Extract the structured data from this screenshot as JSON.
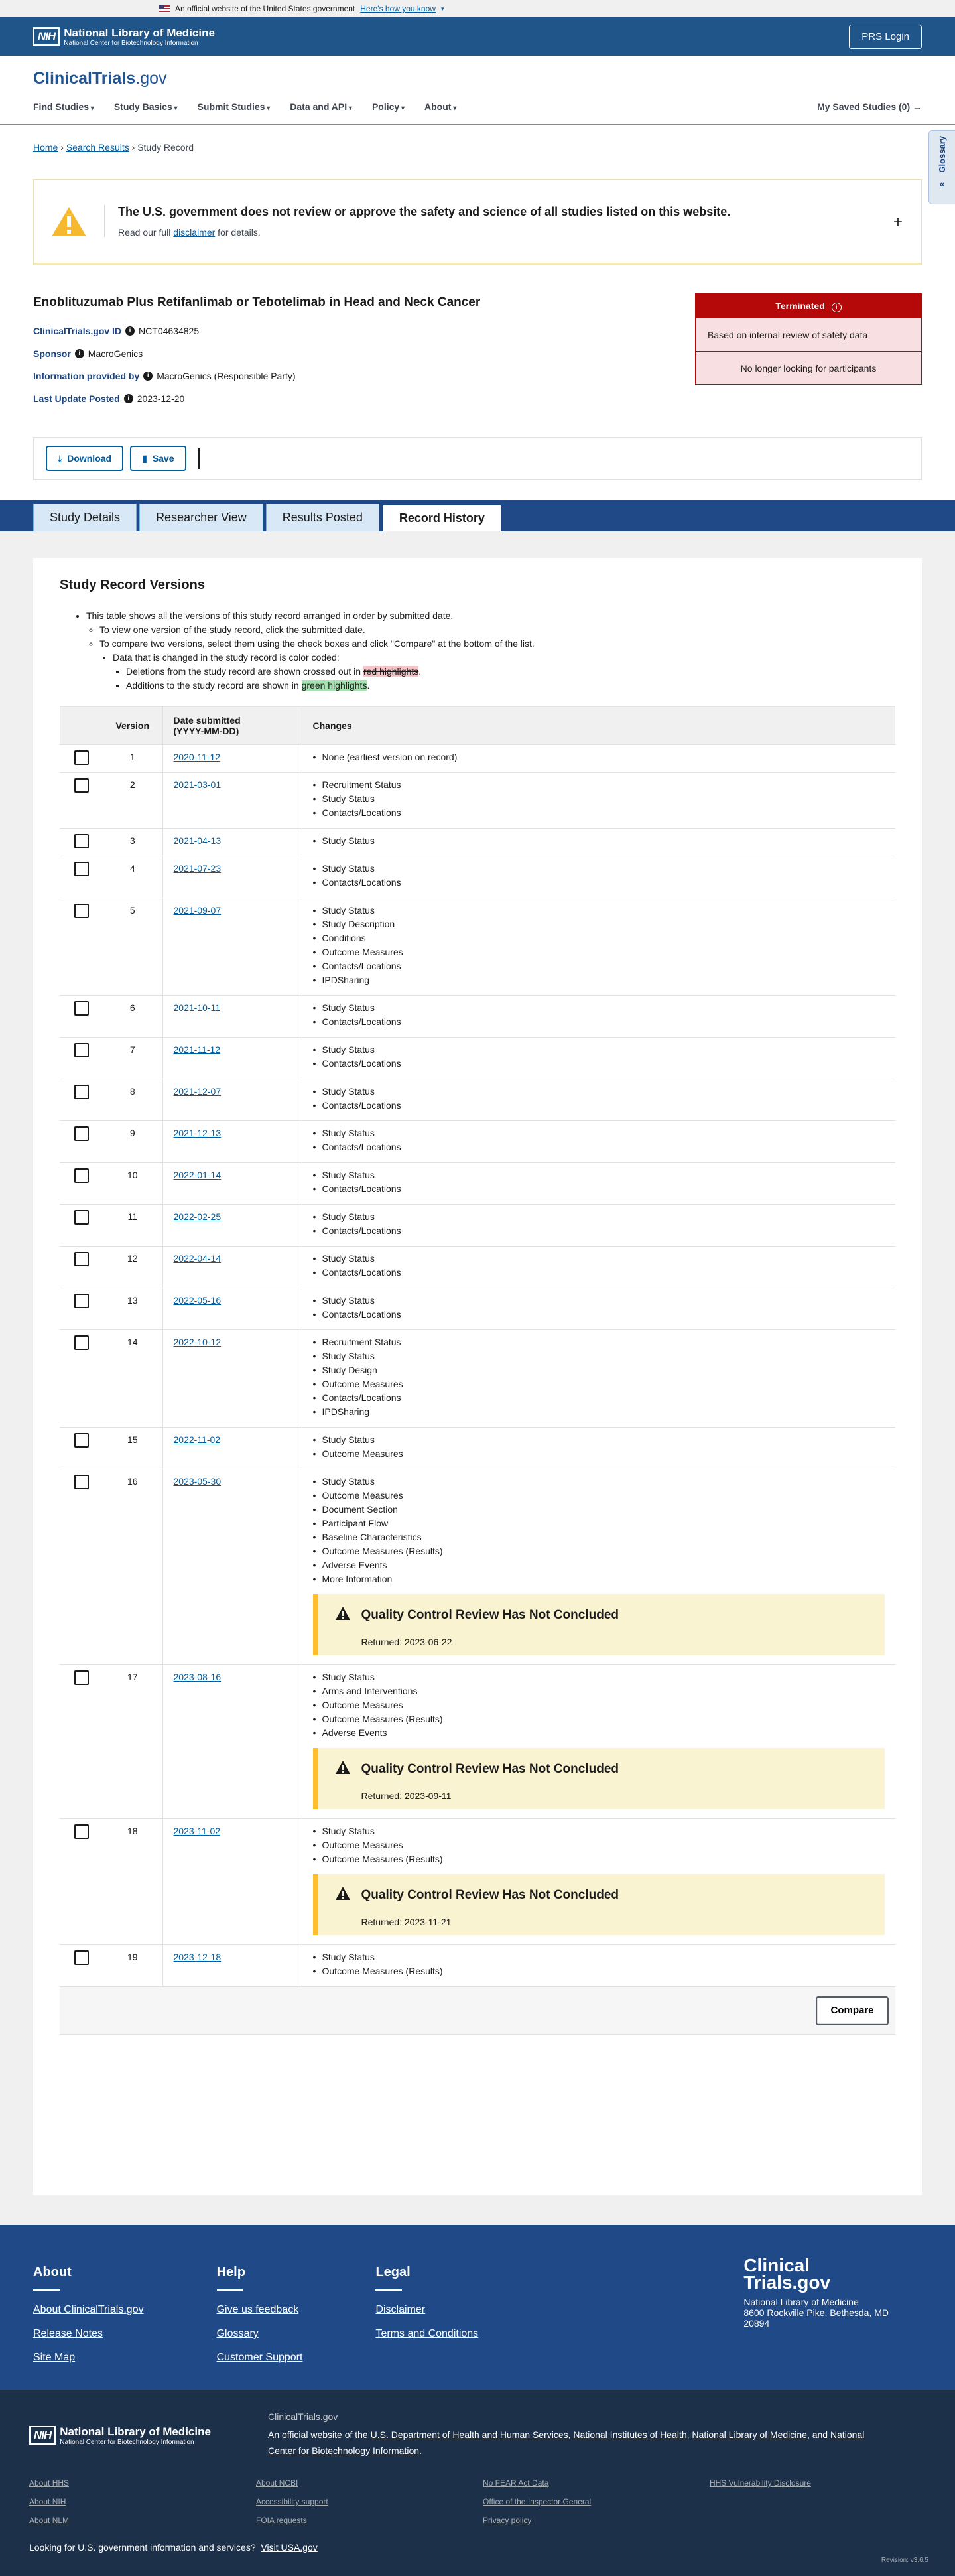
{
  "gov_banner": {
    "text": "An official website of the United States government",
    "link": "Here's how you know"
  },
  "nlm": {
    "abbr": "NIH",
    "line1": "National Library of Medicine",
    "line2": "National Center for Biotechnology Information",
    "prs": "PRS Login"
  },
  "header": {
    "logo_a": "ClinicalTrials",
    "logo_b": ".gov",
    "nav": [
      "Find Studies",
      "Study Basics",
      "Submit Studies",
      "Data and API",
      "Policy",
      "About"
    ],
    "saved": "My Saved Studies (0) →"
  },
  "breadcrumb": {
    "home": "Home",
    "results": "Search Results",
    "current": "Study Record"
  },
  "glossary": "Glossary",
  "notice": {
    "title": "The U.S. government does not review or approve the safety and science of all studies listed on this website.",
    "pre": "Read our full ",
    "link": "disclaimer",
    "post": " for details."
  },
  "study": {
    "title": "Enoblituzumab Plus Retifanlimab or Tebotelimab in Head and Neck Cancer",
    "id_label": "ClinicalTrials.gov ID",
    "id": "NCT04634825",
    "sponsor_label": "Sponsor",
    "sponsor": "MacroGenics",
    "info_label": "Information provided by",
    "info": "MacroGenics (Responsible Party)",
    "update_label": "Last Update Posted",
    "update": "2023-12-20"
  },
  "status": {
    "label": "Terminated",
    "reason": "Based on internal review of safety data",
    "recruit": "No longer looking for participants",
    "color": "#b50909"
  },
  "actions": {
    "download": "Download",
    "save": "Save"
  },
  "tabs": [
    "Study Details",
    "Researcher View",
    "Results Posted",
    "Record History"
  ],
  "versions": {
    "heading": "Study Record Versions",
    "intro": "This table shows all the versions of this study record arranged in order by submitted date.",
    "b1": "To view one version of the study record, click the submitted date.",
    "b2": "To compare two versions, select them using the check boxes and click \"Compare\" at the bottom of the list.",
    "b3": "Data that is changed in the study record is color coded:",
    "del_pre": "Deletions from the study record are shown crossed out in ",
    "del_hl": "red highlights",
    "del_post": ".",
    "add_pre": "Additions to the study record are shown in ",
    "add_hl": "green highlights",
    "add_post": ".",
    "col_version": "Version",
    "col_date1": "Date submitted",
    "col_date2": "(YYYY-MM-DD)",
    "col_changes": "Changes",
    "qc_title": "Quality Control Review Has Not Concluded",
    "compare": "Compare"
  },
  "rows": [
    {
      "v": "1",
      "date": "2020-11-12",
      "changes": [
        "None (earliest version on record)"
      ]
    },
    {
      "v": "2",
      "date": "2021-03-01",
      "changes": [
        "Recruitment Status",
        "Study Status",
        "Contacts/Locations"
      ]
    },
    {
      "v": "3",
      "date": "2021-04-13",
      "changes": [
        "Study Status"
      ]
    },
    {
      "v": "4",
      "date": "2021-07-23",
      "changes": [
        "Study Status",
        "Contacts/Locations"
      ]
    },
    {
      "v": "5",
      "date": "2021-09-07",
      "changes": [
        "Study Status",
        "Study Description",
        "Conditions",
        "Outcome Measures",
        "Contacts/Locations",
        "IPDSharing"
      ]
    },
    {
      "v": "6",
      "date": "2021-10-11",
      "changes": [
        "Study Status",
        "Contacts/Locations"
      ]
    },
    {
      "v": "7",
      "date": "2021-11-12",
      "changes": [
        "Study Status",
        "Contacts/Locations"
      ]
    },
    {
      "v": "8",
      "date": "2021-12-07",
      "changes": [
        "Study Status",
        "Contacts/Locations"
      ]
    },
    {
      "v": "9",
      "date": "2021-12-13",
      "changes": [
        "Study Status",
        "Contacts/Locations"
      ]
    },
    {
      "v": "10",
      "date": "2022-01-14",
      "changes": [
        "Study Status",
        "Contacts/Locations"
      ]
    },
    {
      "v": "11",
      "date": "2022-02-25",
      "changes": [
        "Study Status",
        "Contacts/Locations"
      ]
    },
    {
      "v": "12",
      "date": "2022-04-14",
      "changes": [
        "Study Status",
        "Contacts/Locations"
      ]
    },
    {
      "v": "13",
      "date": "2022-05-16",
      "changes": [
        "Study Status",
        "Contacts/Locations"
      ]
    },
    {
      "v": "14",
      "date": "2022-10-12",
      "changes": [
        "Recruitment Status",
        "Study Status",
        "Study Design",
        "Outcome Measures",
        "Contacts/Locations",
        "IPDSharing"
      ]
    },
    {
      "v": "15",
      "date": "2022-11-02",
      "changes": [
        "Study Status",
        "Outcome Measures"
      ]
    },
    {
      "v": "16",
      "date": "2023-05-30",
      "changes": [
        "Study Status",
        "Outcome Measures",
        "Document Section",
        "Participant Flow",
        "Baseline Characteristics",
        "Outcome Measures (Results)",
        "Adverse Events",
        "More Information"
      ],
      "qc": "Returned: 2023-06-22"
    },
    {
      "v": "17",
      "date": "2023-08-16",
      "changes": [
        "Study Status",
        "Arms and Interventions",
        "Outcome Measures",
        "Outcome Measures (Results)",
        "Adverse Events"
      ],
      "qc": "Returned: 2023-09-11"
    },
    {
      "v": "18",
      "date": "2023-11-02",
      "changes": [
        "Study Status",
        "Outcome Measures",
        "Outcome Measures (Results)"
      ],
      "qc": "Returned: 2023-11-21"
    },
    {
      "v": "19",
      "date": "2023-12-18",
      "changes": [
        "Study Status",
        "Outcome Measures (Results)"
      ]
    }
  ],
  "footer": {
    "about": {
      "title": "About",
      "links": [
        "About ClinicalTrials.gov",
        "Release Notes",
        "Site Map"
      ]
    },
    "help": {
      "title": "Help",
      "links": [
        "Give us feedback",
        "Glossary",
        "Customer Support"
      ]
    },
    "legal": {
      "title": "Legal",
      "links": [
        "Disclaimer",
        "Terms and Conditions"
      ]
    },
    "logo1": "Clinical",
    "logo2": "Trials.gov",
    "addr1": "National Library of Medicine",
    "addr2": "8600 Rockville Pike, Bethesda, MD",
    "addr3": "20894",
    "ctg": "ClinicalTrials.gov",
    "official_pre": "An official website of the ",
    "hhs": "U.S. Department of Health and Human Services",
    "nih": "National Institutes of Health",
    "nlm": "National Library of Medicine",
    "and": "and ",
    "ncbi": "National Center for Biotechnology Information",
    "links": [
      "About HHS",
      "About NCBI",
      "No FEAR Act Data",
      "HHS Vulnerability Disclosure",
      "About NIH",
      "Accessibility support",
      "Office of the Inspector General",
      "",
      "About NLM",
      "FOIA requests",
      "Privacy policy",
      ""
    ],
    "usa_pre": "Looking for U.S. government information and services?",
    "usa": "Visit USA.gov",
    "rev": "Revision: v3.6.5"
  }
}
